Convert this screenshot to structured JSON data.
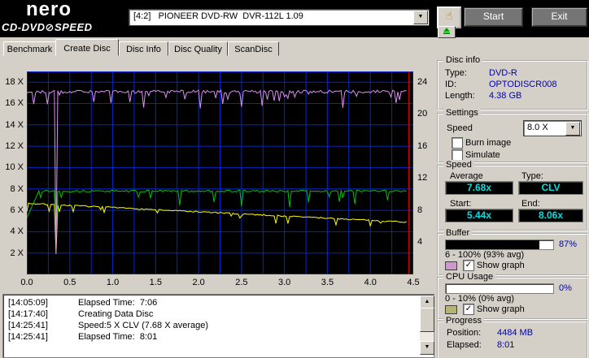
{
  "topbar": {
    "logo_main": "nero",
    "logo_sub": "CD-DVD⊘SPEED",
    "drive": "[4:2]   PIONEER DVD-RW  DVR-112L 1.09",
    "start_label": "Start",
    "exit_label": "Exit"
  },
  "icons": {
    "check": "✓",
    "chevron_down": "▼",
    "scroll_up": "▲",
    "scroll_down": "▼",
    "hand": "☝"
  },
  "tabs": [
    {
      "label": "Benchmark"
    },
    {
      "label": "Create Disc"
    },
    {
      "label": "Disc Info"
    },
    {
      "label": "Disc Quality"
    },
    {
      "label": "ScanDisc"
    }
  ],
  "chart_data": {
    "type": "line",
    "x_ticks": [
      "0.0",
      "0.5",
      "1.0",
      "1.5",
      "2.0",
      "2.5",
      "3.0",
      "3.5",
      "4.0",
      "4.5"
    ],
    "y_left_ticks": [
      "18 X",
      "16 X",
      "14 X",
      "12 X",
      "10 X",
      "8 X",
      "6 X",
      "4 X",
      "2 X"
    ],
    "y_right_ticks": [
      "24",
      "20",
      "16",
      "12",
      "8",
      "4"
    ],
    "x_range": [
      0,
      4.5
    ],
    "y_left_range": [
      0,
      19
    ],
    "y_right_range": [
      0,
      25.3
    ],
    "grid_color": "#0028c8",
    "background": "#000000",
    "end_marker": {
      "x": 4.45,
      "color": "#ff0000"
    },
    "series": [
      {
        "name": "buffer-level",
        "color": "#d98ff2",
        "start_value": 17.0,
        "level": 17.1,
        "end_value": 17.1,
        "dip": {
          "x": 0.34,
          "value": 1.9
        },
        "x_end": 4.42
      },
      {
        "name": "write-speed",
        "color": "#00c400",
        "start_value": 5.3,
        "level": 7.8,
        "end_value": 7.9,
        "dip": {
          "x": 0.34,
          "value": 3.2
        },
        "x_end": 4.42
      },
      {
        "name": "secondary-speed",
        "color": "#ffff00",
        "start_value": 6.65,
        "end_value": 4.9,
        "dip": {
          "x": 0.34,
          "value": 2.0
        },
        "x_end": 4.42
      }
    ]
  },
  "disc_info": {
    "legend": "Disc info",
    "type_label": "Type:",
    "type_value": "DVD-R",
    "id_label": "ID:",
    "id_value": "OPTODISCR008",
    "length_label": "Length:",
    "length_value": "4.38 GB"
  },
  "settings": {
    "legend": "Settings",
    "speed_label": "Speed",
    "speed_value": "8.0 X",
    "burn_image_label": "Burn image",
    "simulate_label": "Simulate",
    "burn_image_checked": false,
    "simulate_checked": false
  },
  "speed_stats": {
    "legend": "Speed",
    "average_label": "Average",
    "type_label": "Type:",
    "average_value": "7.68x",
    "type_value": "CLV",
    "start_label": "Start:",
    "end_label": "End:",
    "start_value": "5.44x",
    "end_value": "8.06x"
  },
  "buffer": {
    "legend": "Buffer",
    "percent": "87%",
    "fill_pct": 87,
    "range_text": "6 - 100% (93% avg)",
    "show_graph_label": "Show graph",
    "show_graph_checked": true,
    "swatch_color": "#cc99cc"
  },
  "cpu": {
    "legend": "CPU Usage",
    "percent": "0%",
    "fill_pct": 0,
    "range_text": "0 - 10% (0% avg)",
    "show_graph_label": "Show graph",
    "show_graph_checked": true,
    "swatch_color": "#b5b573"
  },
  "progress": {
    "legend": "Progress",
    "position_label": "Position:",
    "position_value": "4484 MB",
    "elapsed_label": "Elapsed:",
    "elapsed_value": "8:01"
  },
  "log": {
    "lines": [
      {
        "time": "[14:05:09]",
        "text": "Elapsed Time:  7:06"
      },
      {
        "time": "[14:17:40]",
        "text": "Creating Data Disc"
      },
      {
        "time": "[14:25:41]",
        "text": "Speed:5 X CLV (7.68 X average)"
      },
      {
        "time": "[14:25:41]",
        "text": "Elapsed Time:  8:01"
      }
    ]
  },
  "colors": {
    "value_text": "#0000b0",
    "lcd_text": "#00e0e0",
    "window_bg": "#d4d0c8"
  }
}
